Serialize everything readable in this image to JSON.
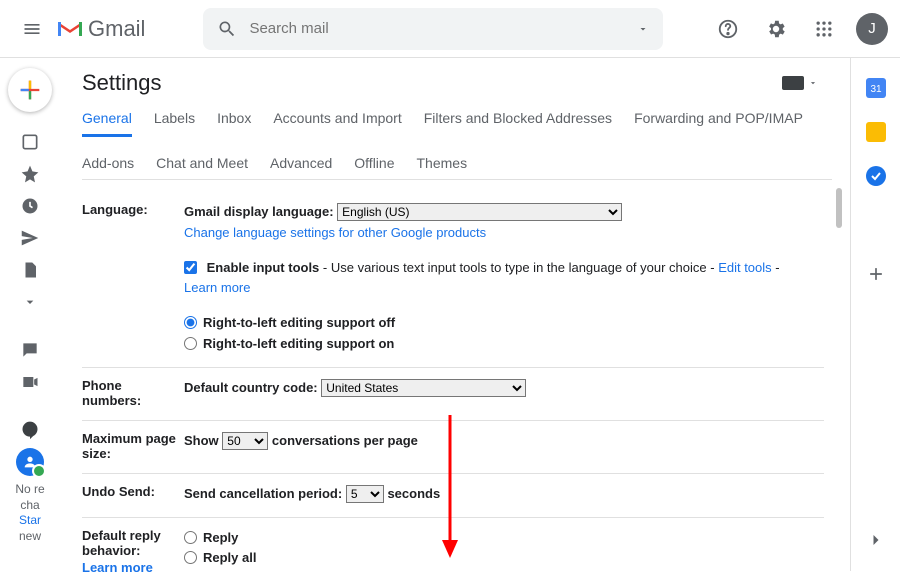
{
  "header": {
    "logo_text": "Gmail",
    "search_placeholder": "Search mail",
    "avatar_letter": "J"
  },
  "left_texts": {
    "l1": "No re",
    "l2": "cha",
    "l3": "Star",
    "l4": "new"
  },
  "settings": {
    "title": "Settings",
    "tabs": [
      "General",
      "Labels",
      "Inbox",
      "Accounts and Import",
      "Filters and Blocked Addresses",
      "Forwarding and POP/IMAP",
      "Add-ons",
      "Chat and Meet",
      "Advanced",
      "Offline",
      "Themes"
    ],
    "active_tab": 0
  },
  "language": {
    "label": "Language:",
    "display_label": "Gmail display language:",
    "display_value": "English (US)",
    "change_link": "Change language settings for other Google products",
    "enable_input": "Enable input tools",
    "enable_desc": " - Use various text input tools to type in the language of your choice - ",
    "edit_tools": "Edit tools",
    "dash": " - ",
    "learn_more": "Learn more",
    "rtl_off": "Right-to-left editing support off",
    "rtl_on": "Right-to-left editing support on"
  },
  "phone": {
    "label": "Phone numbers:",
    "cc_label": "Default country code:",
    "cc_value": "United States"
  },
  "page_size": {
    "label": "Maximum page size:",
    "show": "Show",
    "value": "50",
    "suffix": "conversations per page"
  },
  "undo": {
    "label": "Undo Send:",
    "pre": "Send cancellation period:",
    "value": "5",
    "suf": "seconds"
  },
  "reply": {
    "label": "Default reply behavior:",
    "learn": "Learn more",
    "opt1": "Reply",
    "opt2": "Reply all"
  }
}
